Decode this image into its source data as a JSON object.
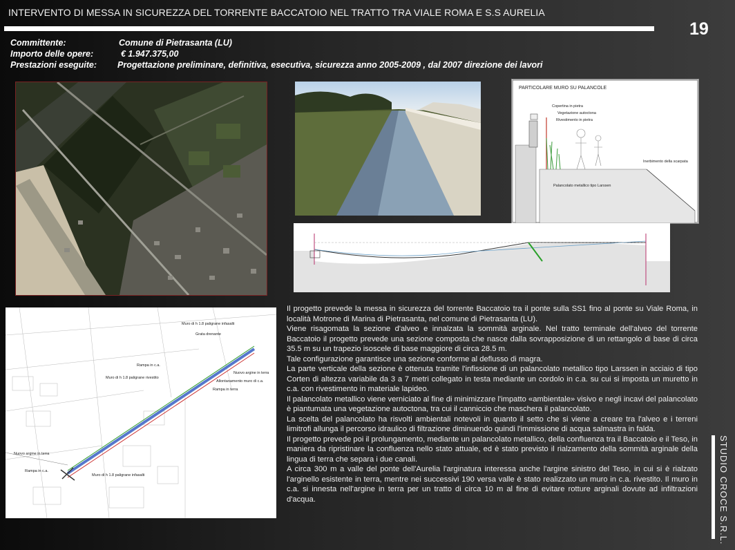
{
  "header": {
    "title": "INTERVENTO DI MESSA IN SICUREZZA DEL TORRENTE BACCATOIO NEL TRATTO TRA VIALE ROMA E S.S AURELIA",
    "page_number": "19"
  },
  "info": {
    "committente_label": "Committente:",
    "committente_value": "Comune di Pietrasanta (LU)",
    "importo_label": "Importo delle opere:",
    "importo_value": "€ 1.947.375,00",
    "prestazioni_label": "Prestazioni eseguite:",
    "prestazioni_value": "Progettazione  preliminare, definitiva, esecutiva, sicurezza anno 2005-2009 , dal 2007 direzione dei lavori"
  },
  "detail_drawing": {
    "title": "PARTICOLARE MURO SU PALANCOLE",
    "labels": [
      "Copertina in pietra",
      "Vegetazione autoctona",
      "Rivestimento in pietra",
      "Inerbimento della scarpata",
      "Palancolato metallico tipo Larssen"
    ]
  },
  "plan_labels": [
    "Muro di h 1.8 paligrane infasalti",
    "Grata drenante",
    "Rampa in c.a.",
    "Muro di h 1.8 paligrane rivestito",
    "Allontanamento muro di c.a.",
    "Rampa in terra",
    "Nuovo argine in terra",
    "Nuovo argine in terra",
    "Muro di h 1.8 paligrane infasalti",
    "Rampa in c.a."
  ],
  "body_paragraphs": [
    "Il progetto prevede la messa in sicurezza del torrente Baccatoio tra il ponte sulla SS1 fino al ponte su Viale Roma, in località Motrone di Marina di Pietrasanta, nel comune di Pietrasanta (LU).",
    "Viene risagomata la sezione d'alveo e innalzata la sommità arginale. Nel tratto terminale dell'alveo del torrente Baccatoio il progetto prevede una sezione composta che nasce dalla sovrapposizione di un rettangolo di base di circa 35.5 m su un trapezio isoscele di base maggiore di circa 28.5 m.",
    "Tale configurazione garantisce una sezione conforme al deflusso di magra.",
    "La parte verticale della sezione è ottenuta tramite l'infissione di un palancolato metallico tipo Larssen in acciaio di tipo Corten di altezza variabile da 3 a 7 metri collegato in testa mediante un cordolo in c.a. su cui si imposta un muretto in c.a. con rivestimento in materiale lapideo.",
    "Il palancolato metallico viene verniciato al fine di minimizzare l'impatto «ambientale» visivo  e negli incavi del palancolato è piantumata una vegetazione autoctona, tra cui il canniccio che maschera il palancolato.",
    "La scelta del palancolato ha risvolti ambientali notevoli in quanto il setto che si viene a creare tra l'alveo e i terreni limitrofi allunga il percorso idraulico di filtrazione diminuendo quindi l'immissione di acqua salmastra in falda.",
    "Il progetto prevede poi il prolungamento, mediante un palancolato metallico, della confluenza tra il Baccatoio e il Teso, in maniera da ripristinare la confluenza nello stato attuale, ed è stato previsto il rialzamento della sommità arginale della lingua di terra che separa i due canali.",
    "A circa 300 m a valle del ponte dell'Aurelia l'arginatura interessa anche l'argine sinistro del Teso, in cui si è rialzato l'arginello esistente in terra, mentre nei successivi 190 versa valle è stato realizzato un muro in c.a. rivestito. Il muro in c.a. si innesta nell'argine in terra per un tratto di circa 10 m al fine di evitare rotture arginali dovute ad infiltrazioni d'acqua."
  ],
  "sidebar_brand": "STUDIO CROCE S.R.L."
}
